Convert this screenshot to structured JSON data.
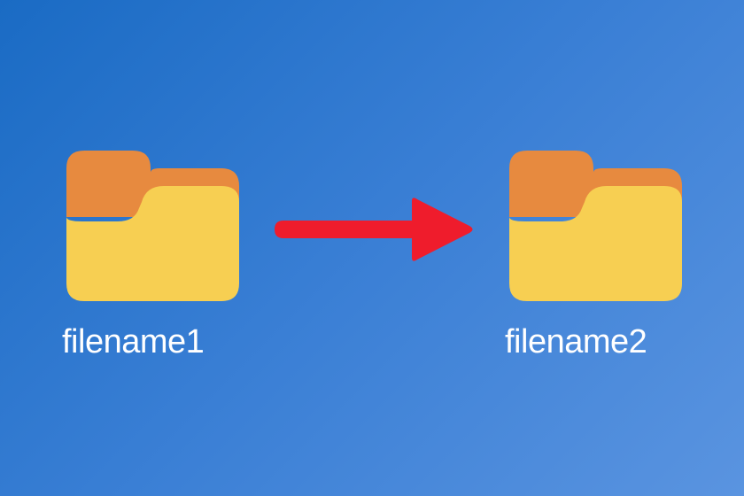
{
  "folders": {
    "source": {
      "label": "filename1"
    },
    "destination": {
      "label": "filename2"
    }
  },
  "colors": {
    "folder_back": "#e78a3f",
    "folder_front": "#f7cf52",
    "arrow": "#ef1c2c",
    "text": "#ffffff"
  }
}
